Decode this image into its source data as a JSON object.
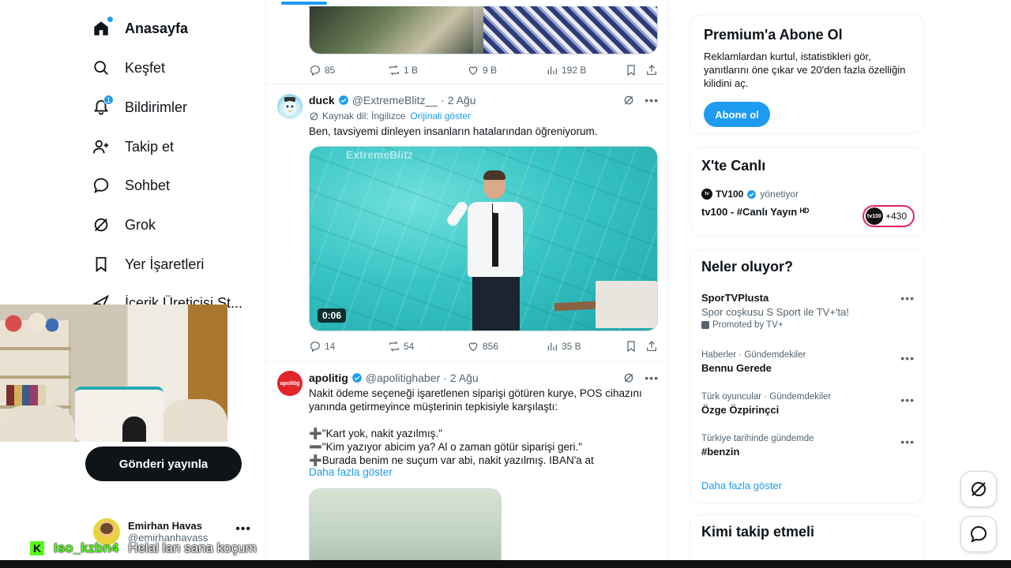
{
  "nav": {
    "items": [
      {
        "label": "Anasayfa",
        "icon": "home-icon"
      },
      {
        "label": "Keşfet",
        "icon": "search-icon"
      },
      {
        "label": "Bildirimler",
        "icon": "bell-icon",
        "badge": "1"
      },
      {
        "label": "Takip et",
        "icon": "add-user-icon"
      },
      {
        "label": "Sohbet",
        "icon": "chat-icon"
      },
      {
        "label": "Grok",
        "icon": "grok-icon"
      },
      {
        "label": "Yer İşaretleri",
        "icon": "bookmark-icon"
      },
      {
        "label": "İçerik Üreticisi St...",
        "icon": "rocket-icon"
      }
    ],
    "post_button": "Gönderi yayınla",
    "profile": {
      "name": "Emirhan Havas",
      "handle": "@emirhanhavass"
    }
  },
  "chat_overlay": {
    "username": "Iso_kzbn4",
    "message": "Helal lan sana koçum"
  },
  "feed": {
    "top_tweet_actions": {
      "replies": "85",
      "reposts": "1 B",
      "likes": "9 B",
      "views": "192 B"
    },
    "tweets": [
      {
        "name": "duck",
        "handle": "@ExtremeBlitz__",
        "time": "2 Ağu",
        "translate_label": "Kaynak dil: İngilizce",
        "translate_link": "Orijinali göster",
        "text": "Ben, tavsiyemi dinleyen insanların hatalarından öğreniyorum.",
        "video_watermark": "ExtremeBlitz",
        "video_duration": "0:06",
        "actions": {
          "replies": "14",
          "reposts": "54",
          "likes": "856",
          "views": "35 B"
        }
      },
      {
        "name": "apolitig",
        "handle": "@apolitighaber",
        "time": "2 Ağu",
        "avatar_text": "apolitig",
        "text": "Nakit ödeme seçeneği işaretlenen siparişi götüren kurye, POS cihazını yanında getirmeyince müşterinin tepkisiyle karşılaştı:\n\n➕\"Kart yok, nakit yazılmış.\"\n➖\"Kim yazıyor abicim ya? Al o zaman götür siparişi geri.\"\n➕Burada benim ne suçum var abi, nakit yazılmış. IBAN'a at",
        "show_more": "Daha fazla göster"
      }
    ]
  },
  "sidebar": {
    "premium": {
      "title": "Premium'a Abone Ol",
      "text": "Reklamlardan kurtul, istatistikleri gör, yanıtlarını öne çıkar ve 20'den fazla özelliğin kilidini aç.",
      "button": "Abone ol"
    },
    "live": {
      "title": "X'te Canlı",
      "host": "TV100",
      "role": "yönetiyor",
      "stream_title": "tv100 - #Canlı Yayın ᴴᴰ",
      "pill_logo": "tv100",
      "pill_count": "+430"
    },
    "trends": {
      "title": "Neler oluyor?",
      "items": [
        {
          "meta": "",
          "title": "SporTVPlusta",
          "desc": "Spor coşkusu S Sport ile TV+'ta!",
          "promo": "Promoted by TV+"
        },
        {
          "meta": "Haberler · Gündemdekiler",
          "title": "Bennu Gerede"
        },
        {
          "meta": "Türk oyuncular · Gündemdekiler",
          "title": "Özge Özpirinçci"
        },
        {
          "meta": "Türkiye tarihinde gündemde",
          "title": "#benzin"
        }
      ],
      "show_more": "Daha fazla göster"
    },
    "who_to_follow": {
      "title": "Kimi takip etmeli"
    }
  },
  "colors": {
    "accent": "#1d9bf0",
    "text": "#0f1419",
    "secondary": "#536471",
    "live": "#e0245e",
    "kick": "#53fc18"
  }
}
